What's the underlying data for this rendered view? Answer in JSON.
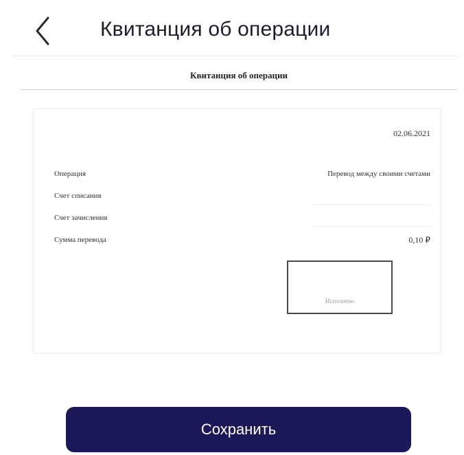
{
  "header": {
    "back_icon": "chevron-left-icon",
    "title": "Квитанция об операции"
  },
  "receipt": {
    "title": "Квитанция об операции",
    "date": "02.06.2021",
    "rows": [
      {
        "label": "Операция",
        "value": "Перевод между своими счетами"
      },
      {
        "label": "Счет списания",
        "value": ""
      },
      {
        "label": "Счет зачисления",
        "value": ""
      },
      {
        "label": "Сумма перевода",
        "value": "0,10 ₽"
      }
    ],
    "signature_label": "Исполнено"
  },
  "actions": {
    "save_label": "Сохранить"
  },
  "colors": {
    "primary_button": "#1b1958",
    "signature_border": "#4a4a4a"
  }
}
